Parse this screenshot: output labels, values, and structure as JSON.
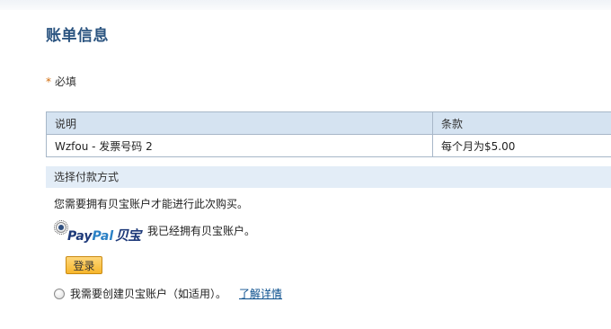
{
  "page_title": "账单信息",
  "required": {
    "asterisk": "*",
    "label": "必填"
  },
  "table": {
    "headers": [
      "说明",
      "条款"
    ],
    "rows": [
      [
        "Wzfou - 发票号码 2",
        "每个月为$5.00"
      ]
    ]
  },
  "payment_section": {
    "title": "选择付款方式",
    "need_account_text": "您需要拥有贝宝账户才能进行此次购买。",
    "options": [
      {
        "logo": {
          "pay": "Pay",
          "pal": "Pal",
          "cn": "贝宝"
        },
        "label": "我已经拥有贝宝账户。",
        "selected": true
      },
      {
        "label": "我需要创建贝宝账户（如适用）。",
        "link": "了解详情",
        "selected": false
      }
    ],
    "login_button": "登录"
  }
}
